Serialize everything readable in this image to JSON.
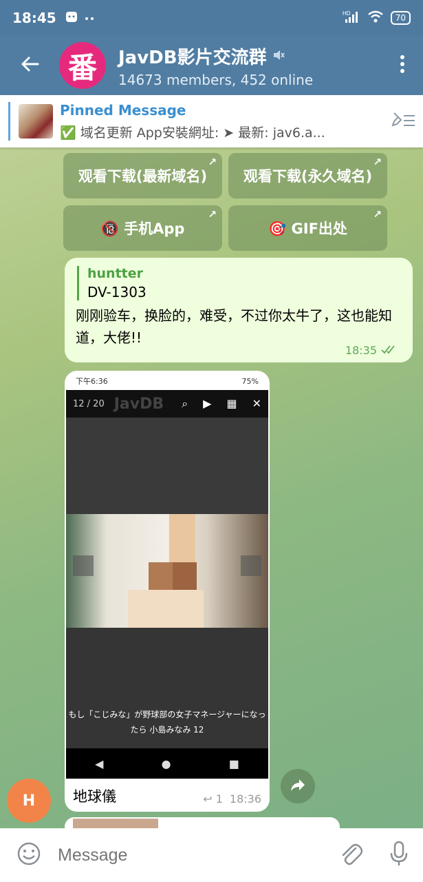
{
  "status_bar": {
    "time": "18:45",
    "battery": "70",
    "network": "HD"
  },
  "header": {
    "avatar_text": "番",
    "title": "JavDB影片交流群",
    "subtitle": "14673 members, 452 online"
  },
  "pinned": {
    "title": "Pinned Message",
    "text": "✅ 域名更新  App安裝網址: ➤  最新: jav6.a..."
  },
  "inline_buttons": [
    {
      "label": "观看下载(最新域名)"
    },
    {
      "label": "观看下载(永久域名)"
    },
    {
      "label": "🔞 手机App"
    },
    {
      "label": "🎯 GIF出处"
    }
  ],
  "message": {
    "reply_name": "huntter",
    "reply_text": "DV-1303",
    "text": "刚刚验车，换脸的，难受，不过你太牛了，这也能知道，大佬!!",
    "time": "18:35"
  },
  "media_message": {
    "screenshot": {
      "status_time": "下午6:36",
      "status_right": "75%",
      "counter": "12 / 20",
      "app_name": "JavDB",
      "caption": "もし「こじみな」が野球部の女子マネージャーになったら 小島みなみ 12"
    },
    "caption": "地球儀",
    "replies": "1",
    "time": "18:36"
  },
  "user_avatar_text": "H",
  "composer": {
    "placeholder": "Message"
  }
}
